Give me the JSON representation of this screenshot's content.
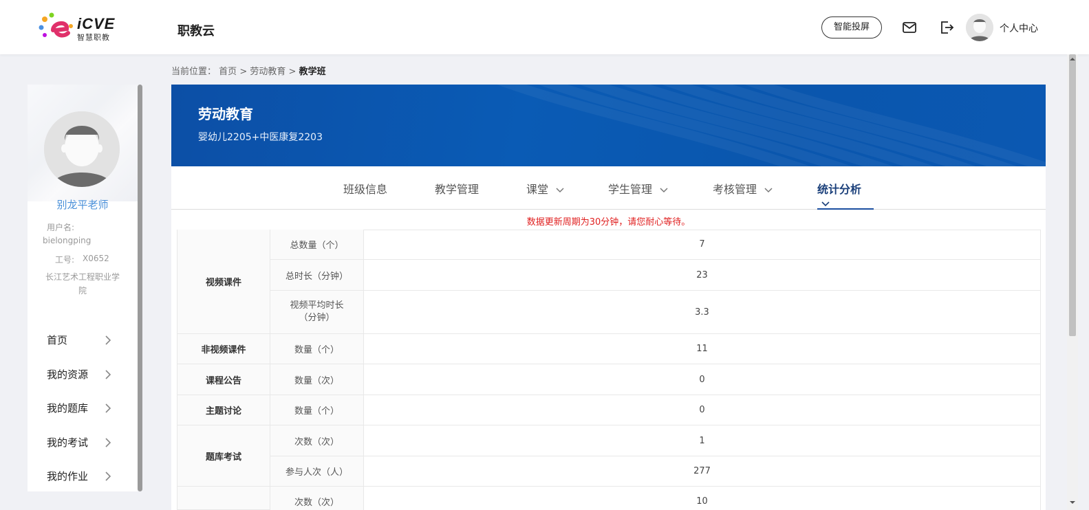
{
  "header": {
    "logo_main": "iCVE",
    "logo_sub": "智慧职教",
    "app_title": "职教云",
    "smart_screen_label": "智能投屏",
    "user_center_label": "个人中心",
    "icons": [
      "mail-icon",
      "logout-icon",
      "avatar"
    ]
  },
  "breadcrumb": {
    "prefix": "当前位置：",
    "home": "首页",
    "sep1": ">",
    "course": "劳动教育",
    "sep2": ">",
    "current": "教学班"
  },
  "sidebar": {
    "teacher_name": "别龙平老师",
    "username_label": "用户名:",
    "username": "bielongping",
    "work_id_label": "工号:",
    "work_id": "X0652",
    "school_line1": "长江艺术工程职业学",
    "school_line2": "院",
    "menu": [
      {
        "label": "首页"
      },
      {
        "label": "我的资源"
      },
      {
        "label": "我的题库"
      },
      {
        "label": "我的考试"
      },
      {
        "label": "我的作业"
      }
    ]
  },
  "banner": {
    "course_title": "劳动教育",
    "class_name": "婴幼儿2205+中医康复2203"
  },
  "tabs": [
    {
      "label": "班级信息",
      "dropdown": false,
      "active": false
    },
    {
      "label": "教学管理",
      "dropdown": false,
      "active": false
    },
    {
      "label": "课堂",
      "dropdown": true,
      "active": false
    },
    {
      "label": "学生管理",
      "dropdown": true,
      "active": false
    },
    {
      "label": "考核管理",
      "dropdown": true,
      "active": false
    },
    {
      "label": "统计分析",
      "dropdown": true,
      "active": true
    }
  ],
  "notice": "数据更新周期为30分钟，请您耐心等待。",
  "stats": {
    "groups": [
      {
        "name": "视频课件",
        "rows": [
          {
            "metric": "总数量（个）",
            "value": "7"
          },
          {
            "metric": "总时长（分钟）",
            "value": "23"
          },
          {
            "metric_line1": "视频平均时长",
            "metric_line2": "（分钟）",
            "value": "3.3"
          }
        ]
      },
      {
        "name": "非视频课件",
        "rows": [
          {
            "metric": "数量（个）",
            "value": "11"
          }
        ]
      },
      {
        "name": "课程公告",
        "rows": [
          {
            "metric": "数量（次）",
            "value": "0"
          }
        ]
      },
      {
        "name": "主题讨论",
        "rows": [
          {
            "metric": "数量（个）",
            "value": "0"
          }
        ]
      },
      {
        "name": "题库考试",
        "rows": [
          {
            "metric": "次数（次）",
            "value": "1"
          },
          {
            "metric": "参与人次（人）",
            "value": "277"
          }
        ]
      },
      {
        "name": "",
        "rows": [
          {
            "metric": "次数（次）",
            "value": "10"
          }
        ]
      }
    ]
  },
  "colors": {
    "brand_blue": "#0a56ad",
    "active_tab": "#1a3f7a",
    "teacher_name": "#4a90d9",
    "notice_red": "#e02020"
  }
}
